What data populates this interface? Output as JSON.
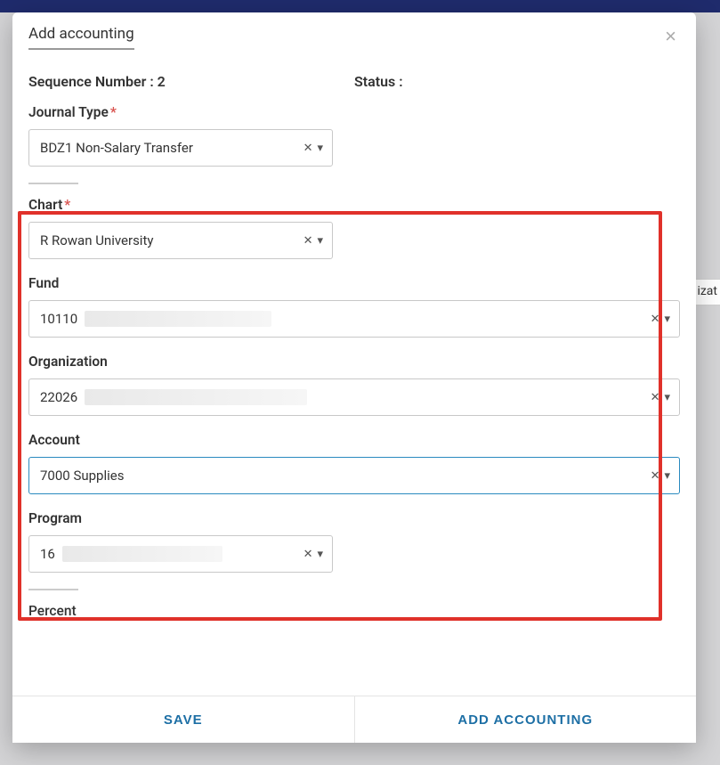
{
  "backgroundSnippet": "izat",
  "modal": {
    "title": "Add accounting",
    "sequenceLabel": "Sequence Number :",
    "sequenceValue": "2",
    "statusLabel": "Status :",
    "statusValue": "",
    "fields": {
      "journalType": {
        "label": "Journal Type",
        "required": true,
        "value": "BDZ1 Non-Salary Transfer"
      },
      "chart": {
        "label": "Chart",
        "required": true,
        "value": "R Rowan University"
      },
      "fund": {
        "label": "Fund",
        "required": false,
        "value": "10110"
      },
      "organization": {
        "label": "Organization",
        "required": false,
        "value": "22026"
      },
      "account": {
        "label": "Account",
        "required": false,
        "value": "7000 Supplies"
      },
      "program": {
        "label": "Program",
        "required": false,
        "value": "16"
      },
      "percent": {
        "label": "Percent"
      }
    },
    "footer": {
      "save": "SAVE",
      "add": "ADD ACCOUNTING"
    }
  },
  "icons": {
    "clear": "✕",
    "caret": "▾",
    "close": "×"
  }
}
